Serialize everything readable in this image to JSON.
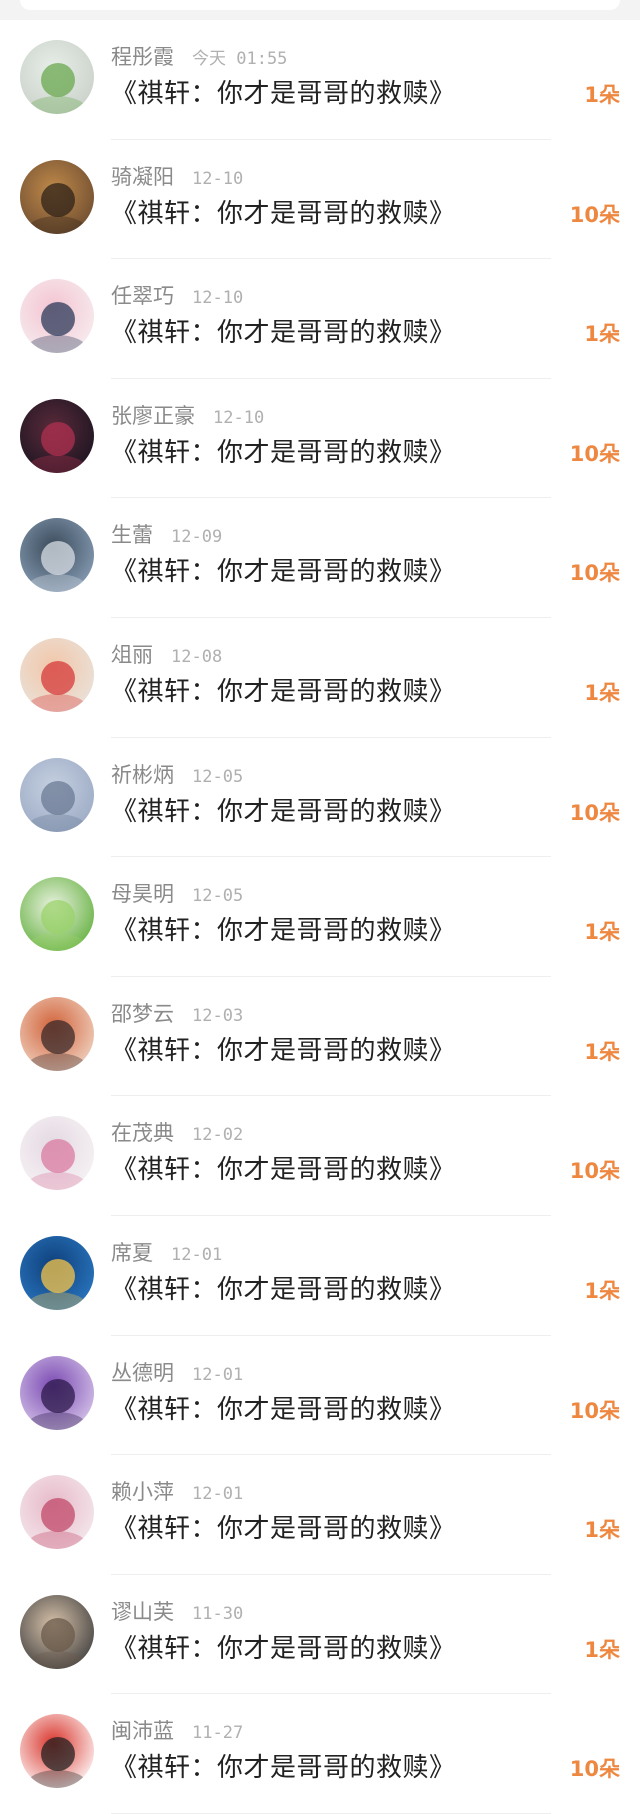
{
  "entries": [
    {
      "name": "程彤霞",
      "time": "今天 01:55",
      "title": "《祺轩：你才是哥哥的救赎》",
      "gift": "1朵",
      "avatar": "succulent-photo",
      "colors": [
        "#c8d0c8",
        "#e8eee8",
        "#6aa84f"
      ]
    },
    {
      "name": "骑凝阳",
      "time": "12-10",
      "title": "《祺轩：你才是哥哥的救赎》",
      "gift": "10朵",
      "avatar": "autumn-road-photo",
      "colors": [
        "#6b4a2f",
        "#c08a4a",
        "#2e2218"
      ]
    },
    {
      "name": "任翠巧",
      "time": "12-10",
      "title": "《祺轩：你才是哥哥的救赎》",
      "gift": "1朵",
      "avatar": "bunny-ears-cartoon",
      "colors": [
        "#f6eef0",
        "#f4c4d2",
        "#2c3a5a"
      ]
    },
    {
      "name": "张廖正豪",
      "time": "12-10",
      "title": "《祺轩：你才是哥哥的救赎》",
      "gift": "10朵",
      "avatar": "dark-couple-photo",
      "colors": [
        "#1a1420",
        "#5a2a3a",
        "#b03050"
      ]
    },
    {
      "name": "生蕾",
      "time": "12-09",
      "title": "《祺轩：你才是哥哥的救赎》",
      "gift": "10朵",
      "avatar": "railway-photo",
      "colors": [
        "#8aa0b8",
        "#3a4a5a",
        "#d8dde4"
      ]
    },
    {
      "name": "俎丽",
      "time": "12-08",
      "title": "《祺轩：你才是哥哥的救赎》",
      "gift": "1朵",
      "avatar": "baby-photo",
      "colors": [
        "#e9e3dc",
        "#f2c6a8",
        "#d63a3a"
      ]
    },
    {
      "name": "祈彬炳",
      "time": "12-05",
      "title": "《祺轩：你才是哥哥的救赎》",
      "gift": "10朵",
      "avatar": "blurred-blue-photo",
      "colors": [
        "#9aa9c4",
        "#c6d0e0",
        "#6b7a94"
      ]
    },
    {
      "name": "母昊明",
      "time": "12-05",
      "title": "《祺轩：你才是哥哥的救赎》",
      "gift": "1朵",
      "avatar": "green-toy-photo",
      "colors": [
        "#5fae3a",
        "#eaf2e0",
        "#9ad26a"
      ]
    },
    {
      "name": "邵梦云",
      "time": "12-03",
      "title": "《祺轩：你才是哥哥的救赎》",
      "gift": "1朵",
      "avatar": "doll-girl-cartoon",
      "colors": [
        "#f1d6c6",
        "#d1633a",
        "#3a2a2a"
      ]
    },
    {
      "name": "在茂典",
      "time": "12-02",
      "title": "《祺轩：你才是哥哥的救赎》",
      "gift": "10朵",
      "avatar": "white-hair-anime",
      "colors": [
        "#f7f3f5",
        "#e4d9e2",
        "#d97aa0"
      ]
    },
    {
      "name": "席夏",
      "time": "12-01",
      "title": "《祺轩：你才是哥哥的救赎》",
      "gift": "1朵",
      "avatar": "blue-lamp-photo",
      "colors": [
        "#2a78c2",
        "#0f3f7a",
        "#f7c64a"
      ]
    },
    {
      "name": "丛德明",
      "time": "12-01",
      "title": "《祺轩：你才是哥哥的救赎》",
      "gift": "10朵",
      "avatar": "purple-anime",
      "colors": [
        "#d8c8ea",
        "#7b4ab3",
        "#2c1a4a"
      ]
    },
    {
      "name": "赖小萍",
      "time": "12-01",
      "title": "《祺轩：你才是哥哥的救赎》",
      "gift": "1朵",
      "avatar": "pink-anime",
      "colors": [
        "#f5e9ee",
        "#e6b9c8",
        "#c24a6a"
      ]
    },
    {
      "name": "谬山芙",
      "time": "11-30",
      "title": "《祺轩：你才是哥哥的救赎》",
      "gift": "1朵",
      "avatar": "boy-photo",
      "colors": [
        "#3c3c3c",
        "#d8c2aa",
        "#6a5a4a"
      ]
    },
    {
      "name": "闽沛蓝",
      "time": "11-27",
      "title": "《祺轩：你才是哥哥的救赎》",
      "gift": "10朵",
      "avatar": "red-cartoon-sticker",
      "colors": [
        "#ffffff",
        "#d9342b",
        "#222222"
      ]
    }
  ]
}
